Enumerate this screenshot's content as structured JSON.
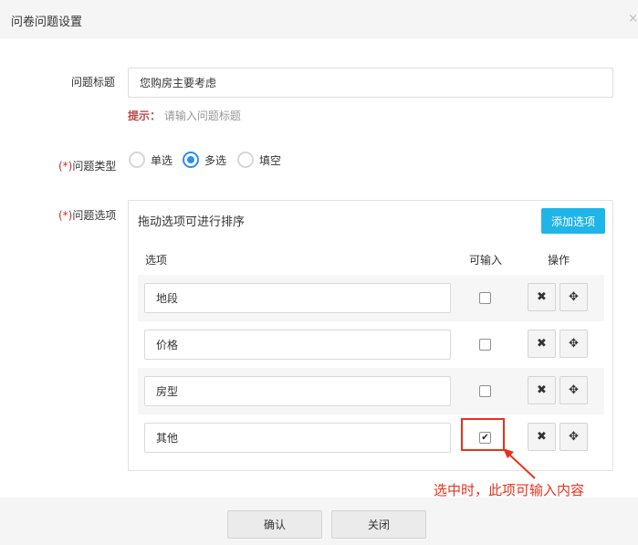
{
  "dialog": {
    "title": "问卷问题设置",
    "close_icon": "×"
  },
  "question_title": {
    "label": "问题标题",
    "value": "您购房主要考虑",
    "hint_key": "提示：",
    "hint_text": "请输入问题标题"
  },
  "question_type": {
    "required_mark": "(*)",
    "label": "问题类型",
    "options": [
      {
        "label": "单选",
        "checked": false
      },
      {
        "label": "多选",
        "checked": true
      },
      {
        "label": "填空",
        "checked": false
      }
    ]
  },
  "question_options": {
    "required_mark": "(*)",
    "label": "问题选项",
    "panel_title": "拖动选项可进行排序",
    "add_button": "添加选项",
    "headers": {
      "option": "选项",
      "inputable": "可输入",
      "actions": "操作"
    },
    "rows": [
      {
        "value": "地段",
        "inputable": false
      },
      {
        "value": "价格",
        "inputable": false
      },
      {
        "value": "房型",
        "inputable": false
      },
      {
        "value": "其他",
        "inputable": true
      }
    ],
    "delete_icon": "✖",
    "move_icon": "✥",
    "check_mark": "✔"
  },
  "annotation": {
    "text": "选中时，此项可输入内容",
    "color": "#e8321d"
  },
  "footer": {
    "confirm": "确认",
    "close": "关闭"
  },
  "colors": {
    "accent_blue": "#2e8ded",
    "add_button": "#1fb5e8",
    "required_red": "#c9302c"
  }
}
